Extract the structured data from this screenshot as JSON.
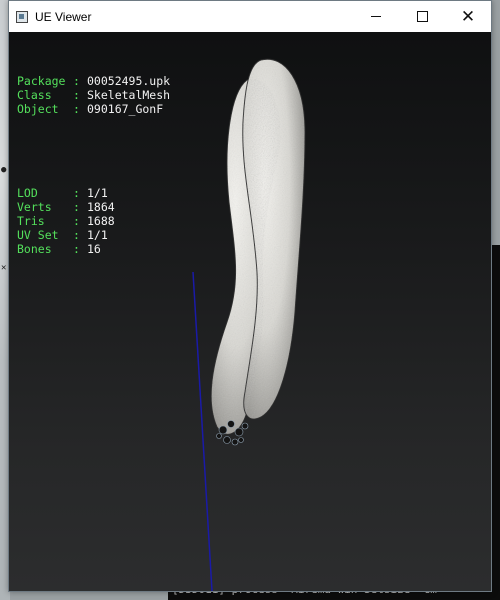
{
  "window": {
    "title": "UE Viewer"
  },
  "info_block": {
    "object_rows": [
      {
        "key": "Package",
        "value": "00052495.upk"
      },
      {
        "key": "Class",
        "value": "SkeletalMesh"
      },
      {
        "key": "Object",
        "value": "090167_GonF"
      }
    ],
    "stats_rows": [
      {
        "key": "LOD",
        "value": "1/1"
      },
      {
        "key": "Verts",
        "value": "1864"
      },
      {
        "key": "Tris",
        "value": "1688"
      },
      {
        "key": "UV Set",
        "value": "1/1"
      },
      {
        "key": "Bones",
        "value": "16"
      }
    ],
    "separator": ":"
  },
  "background_console": {
    "bottom_line": "[D3D011] process 'Mirema win Setsize' cm"
  },
  "colors": {
    "info_label": "#54e05c",
    "info_value": "#f2f2f2",
    "viewport_top": "#0f1011",
    "viewport_bottom": "#2c2d2e",
    "bone_line": "#1a1aa8"
  }
}
